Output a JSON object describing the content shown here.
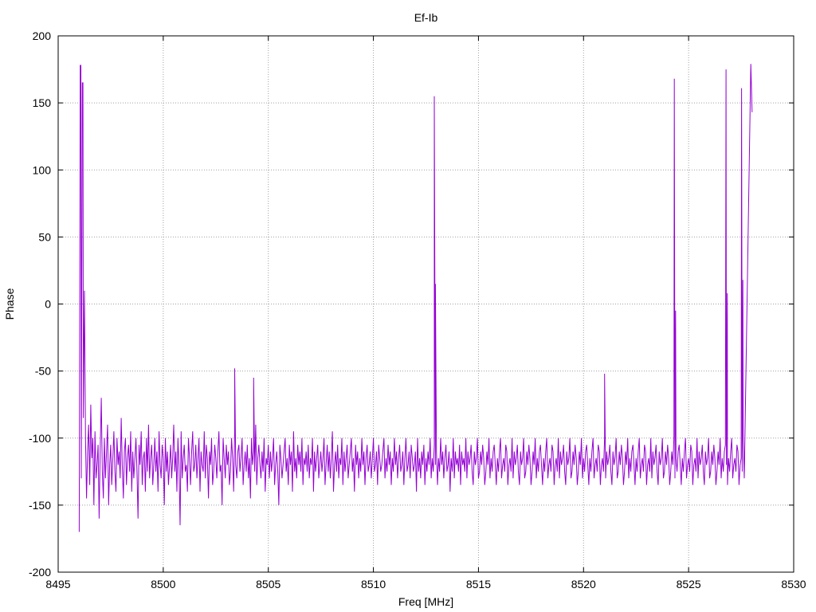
{
  "chart_data": {
    "type": "line",
    "title": "Ef-Ib",
    "xlabel": "Freq [MHz]",
    "ylabel": "Phase",
    "xlim": [
      8495,
      8530
    ],
    "ylim": [
      -200,
      200
    ],
    "x_ticks": [
      8495,
      8500,
      8505,
      8510,
      8515,
      8520,
      8525,
      8530
    ],
    "y_ticks": [
      -200,
      -150,
      -100,
      -50,
      0,
      50,
      100,
      150,
      200
    ],
    "grid": true,
    "line_color": "#9400d3",
    "series": [
      {
        "x_start": 8496.0,
        "x_step": 0.05,
        "values": [
          -170,
          178,
          -130,
          165,
          -85,
          10,
          -100,
          -145,
          -110,
          -90,
          -135,
          -75,
          -115,
          -100,
          -150,
          -95,
          -130,
          -120,
          -105,
          -160,
          -110,
          -70,
          -125,
          -145,
          -100,
          -130,
          -110,
          -90,
          -150,
          -120,
          -105,
          -135,
          -115,
          -95,
          -125,
          -140,
          -100,
          -120,
          -110,
          -130,
          -85,
          -120,
          -145,
          -110,
          -100,
          -135,
          -115,
          -105,
          -125,
          -95,
          -140,
          -110,
          -130,
          -115,
          -100,
          -125,
          -160,
          -105,
          -120,
          -95,
          -135,
          -115,
          -110,
          -140,
          -100,
          -125,
          -90,
          -130,
          -115,
          -105,
          -135,
          -120,
          -100,
          -125,
          -110,
          -140,
          -95,
          -120,
          -130,
          -105,
          -115,
          -150,
          -100,
          -125,
          -110,
          -135,
          -120,
          -105,
          -130,
          -115,
          -90,
          -125,
          -110,
          -140,
          -100,
          -120,
          -165,
          -95,
          -130,
          -115,
          -105,
          -125,
          -120,
          -140,
          -100,
          -115,
          -135,
          -110,
          -95,
          -125,
          -120,
          -105,
          -130,
          -115,
          -100,
          -140,
          -110,
          -120,
          -125,
          -95,
          -130,
          -105,
          -115,
          -145,
          -110,
          -120,
          -100,
          -135,
          -125,
          -105,
          -115,
          -130,
          -110,
          -95,
          -125,
          -120,
          -150,
          -100,
          -115,
          -130,
          -105,
          -120,
          -110,
          -135,
          -125,
          -100,
          -115,
          -140,
          -95,
          -120,
          -130,
          -110,
          -105,
          -125,
          -115,
          -100,
          -135,
          -120,
          -110,
          -125,
          -105,
          -130,
          -115,
          -145,
          -100,
          -120,
          -110,
          -125,
          -90,
          -135,
          -115,
          -105,
          -120,
          -130,
          -110,
          -125,
          -100,
          -140,
          -115,
          -120,
          -105,
          -130,
          -110,
          -125,
          -115,
          -100,
          -135,
          -120,
          -110,
          -125,
          -150,
          -105,
          -115,
          -130,
          -120,
          -110,
          -100,
          -125,
          -115,
          -135,
          -105,
          -120,
          -110,
          -140,
          -95,
          -125,
          -115,
          -130,
          -105,
          -120,
          -110,
          -125,
          -100,
          -135,
          -115,
          -120,
          -110,
          -125,
          -105,
          -130,
          -115,
          -120,
          -100,
          -140,
          -110,
          -125,
          -115,
          -105,
          -130,
          -120,
          -110,
          -125,
          -115,
          -100,
          -135,
          -120,
          -105,
          -125,
          -110,
          -130,
          -115,
          -95,
          -140,
          -120,
          -110,
          -125,
          -105,
          -130,
          -115,
          -120,
          -100,
          -135,
          -110,
          -125,
          -115,
          -105,
          -130,
          -120,
          -110,
          -100,
          -125,
          -115,
          -140,
          -105,
          -120,
          -110,
          -130,
          -115,
          -125,
          -100,
          -120,
          -110,
          -135,
          -115,
          -105,
          -125,
          -120,
          -110,
          -130,
          -115,
          -100,
          -125,
          -120,
          -110,
          -135,
          -105,
          -115,
          -125,
          -120,
          -110,
          -100,
          -130,
          -115,
          -125,
          -105,
          -120,
          -110,
          -135,
          -115,
          -125,
          -100,
          -120,
          -110,
          -130,
          -115,
          -105,
          -125,
          -120,
          -110,
          -135,
          -115,
          -100,
          -125,
          -120,
          -110,
          -130,
          -105,
          -115,
          -125,
          -120,
          -110,
          -140,
          -100,
          -125,
          -115,
          -130,
          -110,
          -120,
          -105,
          -135,
          -115,
          -125,
          -110,
          -120,
          -100,
          -130,
          -115,
          -125,
          -105,
          -120,
          -110,
          -135,
          -115,
          -125,
          -100,
          -120,
          -110,
          -130,
          -115,
          -105,
          -125,
          -120,
          -110,
          -140,
          -115,
          -125,
          -100,
          -130,
          -110,
          -120,
          -115,
          -125,
          -105,
          -135,
          -110,
          -120,
          -115,
          -125,
          -100,
          -130,
          -110,
          -120,
          -115,
          -105,
          -125,
          -135,
          -110,
          -120,
          -115,
          -100,
          -130,
          -125,
          -110,
          -120,
          -105,
          -115,
          -135,
          -125,
          -110,
          -120,
          -100,
          -130,
          -115,
          -125,
          -110,
          -105,
          -120,
          -135,
          -115,
          -125,
          -110,
          -100,
          -130,
          -120,
          -115,
          -125,
          -105,
          -110,
          -135,
          -120,
          -115,
          -125,
          -100,
          -130,
          -110,
          -120,
          -115,
          -105,
          -125,
          -135,
          -110,
          -120,
          -115,
          -100,
          -130,
          -125,
          -110,
          -120,
          -105,
          -115,
          -135,
          -125,
          -110,
          -120,
          -100,
          -130,
          -115,
          -125,
          -110,
          -105,
          -120,
          -135,
          -115,
          -125,
          -110,
          -100,
          -130,
          -120,
          -115,
          -125,
          -105,
          -110,
          -135,
          -120,
          -115,
          -125,
          -100,
          -130,
          -110,
          -120,
          -115,
          -105,
          -125,
          -135,
          -110,
          -120,
          -115,
          -100,
          -130,
          -125,
          -110,
          -120,
          -105,
          -115,
          -135,
          -125,
          -110,
          -120,
          -100,
          -130,
          -115,
          -125,
          -110,
          -105,
          -120,
          -135,
          -115,
          -125,
          -110,
          -100,
          -130,
          -120,
          -115,
          -125,
          -105,
          -110,
          -135,
          -120,
          -115,
          -125,
          -100,
          -130,
          -110,
          -120,
          -115,
          -105,
          -125,
          -135,
          -110,
          -120,
          -115,
          -100,
          -130,
          -125,
          -110,
          -120,
          -105,
          -115,
          -135,
          -125,
          -110,
          -120,
          -100,
          -130,
          -115,
          -125,
          -110,
          -105,
          -120,
          -135,
          -115,
          -125,
          -110,
          -100,
          -130,
          -120,
          -115,
          -125,
          -105,
          -110,
          -135,
          -120,
          -115,
          -125,
          -100,
          -130,
          -110,
          -120,
          -115,
          -105,
          -125,
          -135,
          -110,
          -120,
          -115,
          -100,
          -130,
          -125,
          -110,
          -120,
          -105,
          -115,
          -135,
          -125,
          -110,
          -120,
          -100,
          -130,
          -115,
          -125,
          -110,
          -105,
          -120,
          -135,
          -115,
          -125,
          -110,
          -100,
          -130,
          -120,
          -115,
          -125,
          -105,
          -110,
          -135,
          -120,
          -115,
          -125,
          -100,
          -130,
          -110,
          -120,
          -115,
          -105,
          -125,
          -135,
          -110,
          -120,
          -115,
          -100,
          -130,
          -125,
          -110,
          -120,
          -105,
          -115,
          -135,
          -125,
          -110,
          -120,
          -100,
          -130,
          -115,
          -125,
          -110,
          -105,
          -120,
          -135,
          -115,
          -125,
          -110,
          -100,
          -130,
          -120,
          -115,
          -125,
          -105,
          -110,
          -135,
          -120,
          -115,
          -125,
          -100,
          -130
        ],
        "spikes": [
          {
            "x": 8496.08,
            "y": 178
          },
          {
            "x": 8496.18,
            "y": 165
          },
          {
            "x": 8503.4,
            "y": -48
          },
          {
            "x": 8504.3,
            "y": -55
          },
          {
            "x": 8512.9,
            "y": 155
          },
          {
            "x": 8512.95,
            "y": 15
          },
          {
            "x": 8521.0,
            "y": -52
          },
          {
            "x": 8524.32,
            "y": 168
          },
          {
            "x": 8524.38,
            "y": -5
          },
          {
            "x": 8526.78,
            "y": 175
          },
          {
            "x": 8526.84,
            "y": 8
          },
          {
            "x": 8527.52,
            "y": 161
          },
          {
            "x": 8527.58,
            "y": 18
          },
          {
            "x": 8527.96,
            "y": 179
          },
          {
            "x": 8528.02,
            "y": 143
          }
        ]
      }
    ]
  }
}
